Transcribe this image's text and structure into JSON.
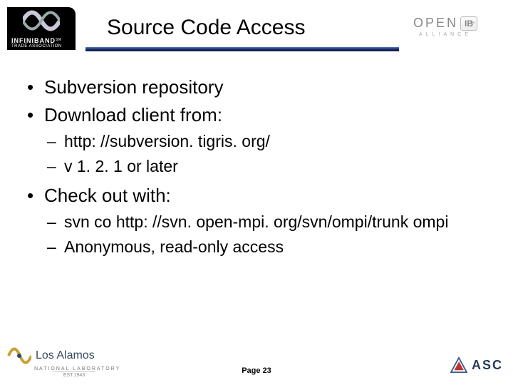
{
  "header": {
    "title": "Source Code Access",
    "logo_left": {
      "brand": "INFINIBAND",
      "sub": "TRADE ASSOCIATION",
      "tm": "SM"
    },
    "logo_right": {
      "brand": "OPEN",
      "box": "IB",
      "sub": "ALLIANCE",
      "tm": "™"
    }
  },
  "body": {
    "items": [
      {
        "text": "Subversion repository"
      },
      {
        "text": "Download client from:",
        "sub": [
          {
            "text": "http: //subversion. tigris. org/"
          },
          {
            "text": "v 1. 2. 1 or later"
          }
        ]
      },
      {
        "text": "Check out with:",
        "sub": [
          {
            "text": "svn co http: //svn. open-mpi. org/svn/ompi/trunk ompi"
          },
          {
            "text": "Anonymous, read-only access"
          }
        ]
      }
    ]
  },
  "footer": {
    "page": "Page 23",
    "la": {
      "name": "Los Alamos",
      "nat": "NATIONAL LABORATORY",
      "est": "EST.1943"
    },
    "asc": {
      "name": "ASC"
    }
  }
}
